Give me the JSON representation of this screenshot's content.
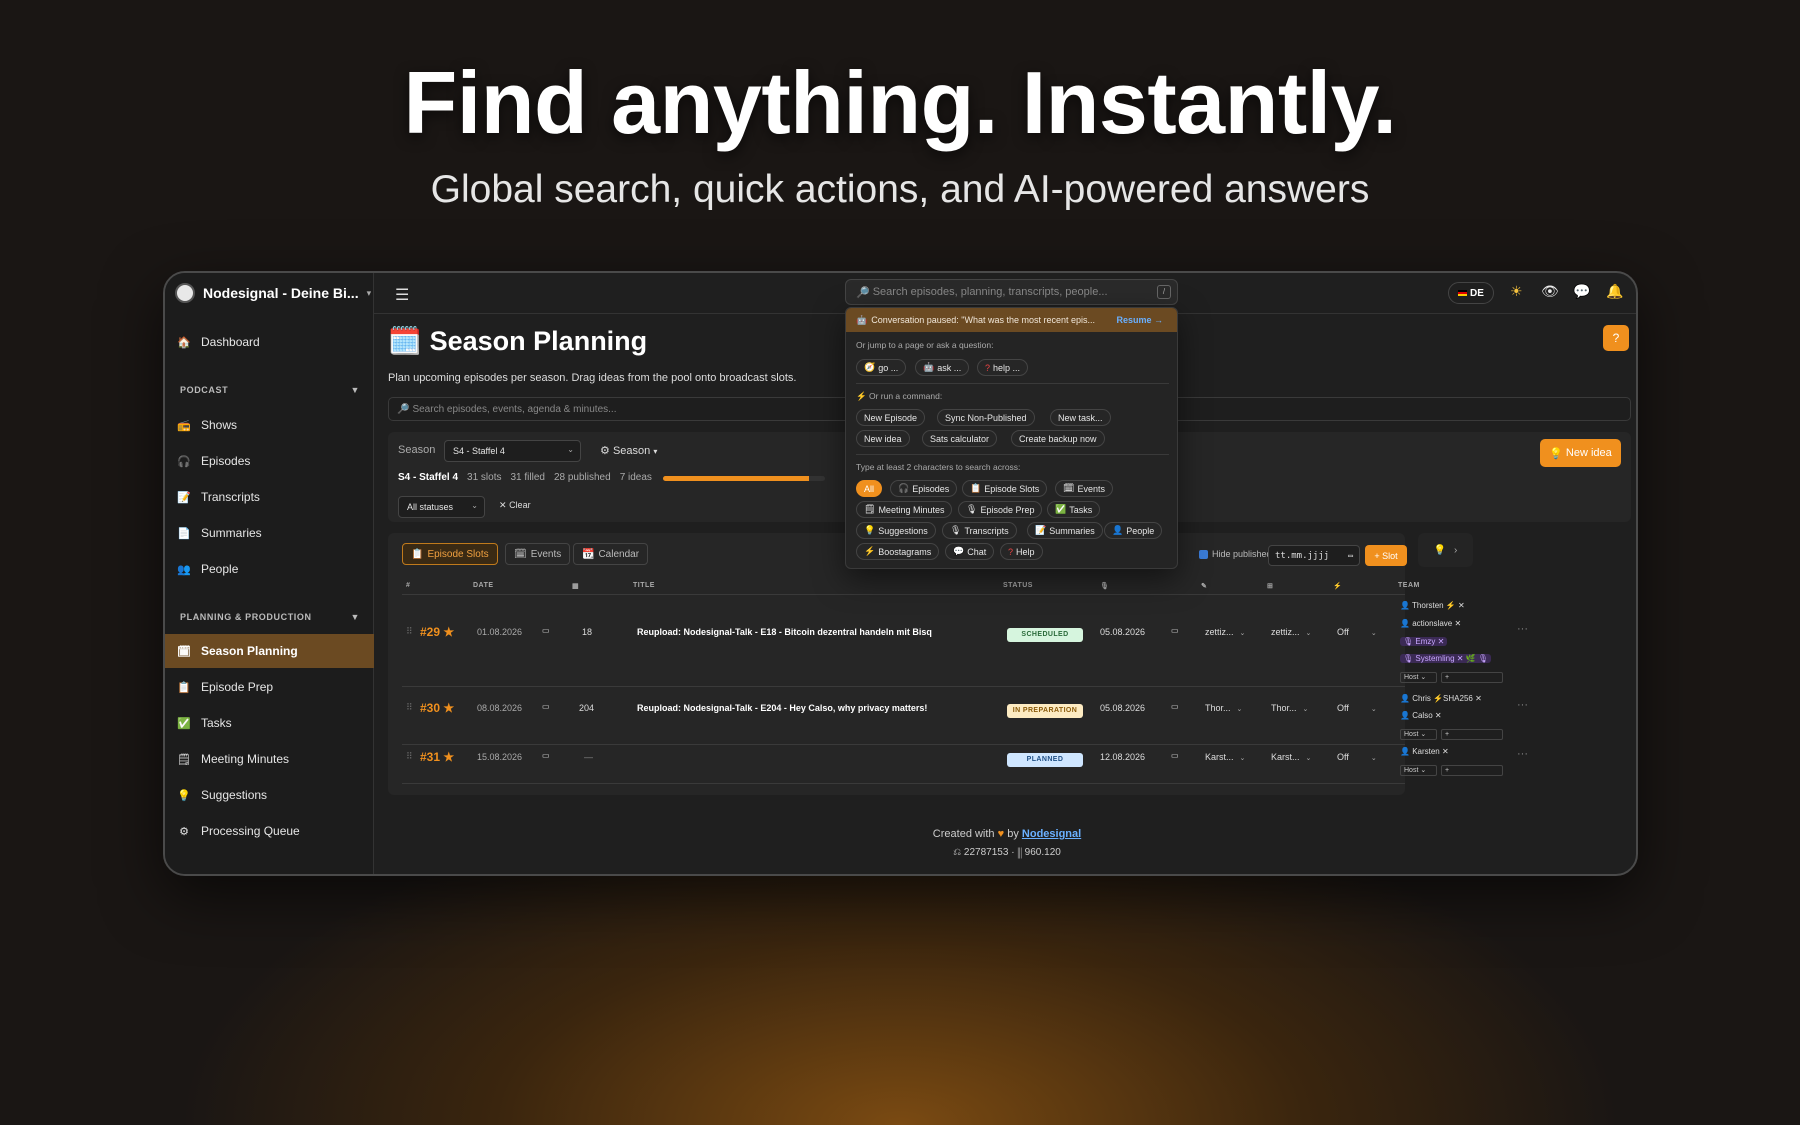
{
  "hero": {
    "title": "Find anything. Instantly.",
    "subtitle": "Global search, quick actions, and AI-powered answers"
  },
  "app": {
    "brand": "Nodesignal - Deine Bi...",
    "search_placeholder": "Search episodes, planning, transcripts, people...",
    "search_shortcut": "/",
    "language": "DE",
    "colors": {
      "accent": "#f0901e",
      "active_nav": "#6b4a22"
    }
  },
  "sidebar": {
    "dashboard": "Dashboard",
    "podcast_section": "PODCAST",
    "podcast_items": [
      "Shows",
      "Episodes",
      "Transcripts",
      "Summaries",
      "People"
    ],
    "planning_section": "PLANNING & PRODUCTION",
    "planning_items": [
      "Season Planning",
      "Episode Prep",
      "Tasks",
      "Meeting Minutes",
      "Suggestions",
      "Processing Queue"
    ]
  },
  "main": {
    "title": "Season Planning",
    "description": "Plan upcoming episodes per season. Drag ideas from the pool onto broadcast slots.",
    "help": "?",
    "search_placeholder": "Search episodes, events, agenda & minutes...",
    "season_label": "Season",
    "season_value": "S4 - Staffel 4",
    "season_button": "Season",
    "stats": {
      "name": "S4 - Staffel 4",
      "slots": "31 slots",
      "filled": "31 filled",
      "published": "28 published",
      "ideas": "7 ideas",
      "progress": 0.9
    },
    "status_filter": "All statuses",
    "clear": "Clear",
    "new_idea": "New idea"
  },
  "table": {
    "tabs": [
      "Episode Slots",
      "Events",
      "Calendar"
    ],
    "hide_published": "Hide published",
    "date_placeholder": "tt.mm.jjjj",
    "add_slot": "+ Slot",
    "headers": [
      "#",
      "DATE",
      "TITLE",
      "STATUS",
      "TEAM"
    ],
    "rows": [
      {
        "num": "#29",
        "date": "01.08.2026",
        "count": "18",
        "title": "Reupload: Nodesignal-Talk - E18 - Bitcoin dezentral handeln mit Bisq",
        "status": "SCHEDULED",
        "pub_date": "05.08.2026",
        "sel1": "zettiz...",
        "sel2": "zettiz...",
        "sel3": "Off",
        "team": [
          "Thorsten",
          "actionslave",
          "Emzy",
          "Systemling"
        ],
        "role": "Host",
        "role_add": "+"
      },
      {
        "num": "#30",
        "date": "08.08.2026",
        "count": "204",
        "title": "Reupload: Nodesignal-Talk - E204 - Hey Calso, why privacy matters!",
        "status": "IN PREPARATION",
        "pub_date": "05.08.2026",
        "sel1": "Thor...",
        "sel2": "Thor...",
        "sel3": "Off",
        "team": [
          "Chris",
          "SHA256",
          "Calso"
        ],
        "role": "Host",
        "role_add": "+"
      },
      {
        "num": "#31",
        "date": "15.08.2026",
        "count": "—",
        "title": "",
        "status": "PLANNED",
        "pub_date": "12.08.2026",
        "sel1": "Karst...",
        "sel2": "Karst...",
        "sel3": "Off",
        "team": [
          "Karsten"
        ],
        "role": "Host",
        "role_add": "+"
      }
    ],
    "status_colors": {
      "SCHEDULED": "#d6f5de",
      "IN PREPARATION": "#fdebc2",
      "PLANNED": "#cfe6ff"
    }
  },
  "dropdown": {
    "resume_text": "Conversation paused: \"What was the most recent epis...",
    "resume_action": "Resume →",
    "jump_label": "Or jump to a page or ask a question:",
    "jump_chips": [
      "go ...",
      "ask ...",
      "help ..."
    ],
    "command_label": "Or run a command:",
    "commands": [
      "New Episode",
      "Sync Non-Published",
      "New task...",
      "New idea",
      "Sats calculator",
      "Create backup now"
    ],
    "type_label": "Type at least 2 characters to search across:",
    "scopes": [
      "All",
      "Episodes",
      "Episode Slots",
      "Events",
      "Meeting Minutes",
      "Episode Prep",
      "Tasks",
      "Suggestions",
      "Transcripts",
      "Summaries",
      "People",
      "Boostagrams",
      "Chat",
      "Help"
    ]
  },
  "footer": {
    "created_with": "Created with",
    "by": "by",
    "link": "Nodesignal",
    "stats": "⎌ 22787153 · ⫼ 960.120"
  }
}
